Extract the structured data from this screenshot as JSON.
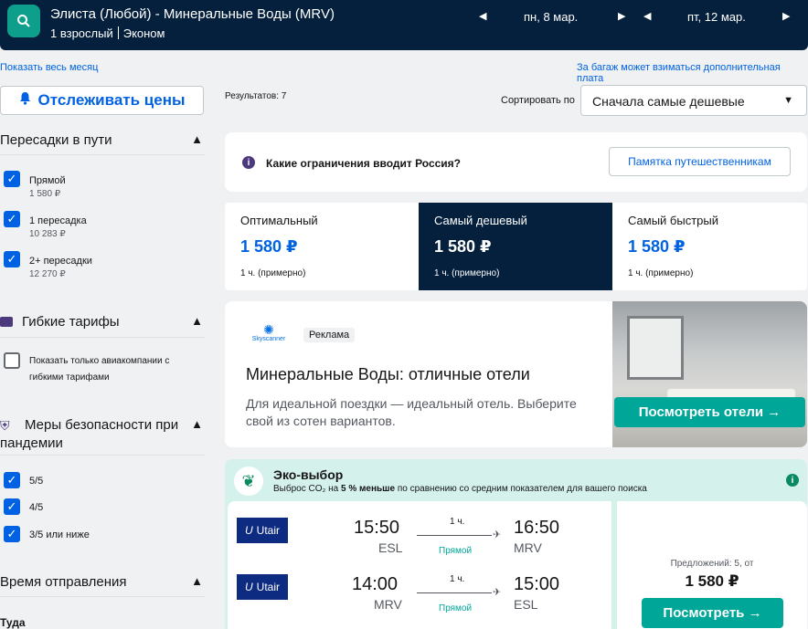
{
  "header": {
    "route": "Элиста (Любой) - Минеральные Воды (MRV)",
    "passengers": "1 взрослый",
    "cabin": "Эконом",
    "depart_date": "пн, 8 мар.",
    "return_date": "пт, 12 мар."
  },
  "links": {
    "show_month": "Показать весь месяц",
    "baggage_note": "За багаж может взиматься дополнительная плата"
  },
  "sidebar": {
    "track_prices": "Отслеживать цены",
    "stops": {
      "title": "Пересадки в пути",
      "options": [
        {
          "label": "Прямой",
          "price": "1 580 ₽"
        },
        {
          "label": "1 пересадка",
          "price": "10 283 ₽"
        },
        {
          "label": "2+ пересадки",
          "price": "12 270 ₽"
        }
      ]
    },
    "flex": {
      "title": "Гибкие тарифы",
      "option_line1": "Показать только авиакомпании с",
      "option_line2": "гибкими тарифами"
    },
    "safety": {
      "title_line1": "Меры безопасности при",
      "title_line2": "пандемии",
      "options": [
        "5/5",
        "4/5",
        "3/5 или ниже"
      ]
    },
    "departure": {
      "title": "Время отправления",
      "sub": "Туда"
    }
  },
  "main": {
    "results": "Результатов: 7",
    "sort_label": "Сортировать по",
    "sort_value": "Сначала самые дешевые",
    "info": {
      "text": "Какие ограничения вводит Россия?",
      "button": "Памятка путешественникам"
    },
    "tabs": [
      {
        "name": "Оптимальный",
        "price": "1 580 ₽",
        "duration": "1 ч. (примерно)"
      },
      {
        "name": "Самый дешевый",
        "price": "1 580 ₽",
        "duration": "1 ч. (примерно)"
      },
      {
        "name": "Самый быстрый",
        "price": "1 580 ₽",
        "duration": "1 ч. (примерно)"
      }
    ],
    "ad": {
      "logo": "Skyscanner",
      "badge": "Реклама",
      "title": "Минеральные Воды: отличные отели",
      "text": "Для идеальной поездки — идеальный отель. Выберите свой из сотен вариантов.",
      "button": "Посмотреть отели →"
    },
    "eco": {
      "title": "Эко-выбор",
      "text_before": "Выброс CO₂ на",
      "text_bold": "5 % меньше",
      "text_after": "по сравнению со средним показателем для вашего поиска"
    },
    "flight": {
      "airline": "Utair",
      "legs": [
        {
          "dep_time": "15:50",
          "dep_code": "ESL",
          "arr_time": "16:50",
          "arr_code": "MRV",
          "duration": "1 ч.",
          "type": "Прямой"
        },
        {
          "dep_time": "14:00",
          "dep_code": "MRV",
          "arr_time": "15:00",
          "arr_code": "ESL",
          "duration": "1 ч.",
          "type": "Прямой"
        }
      ],
      "offers": "Предложений: 5, от",
      "price": "1 580 ₽",
      "button": "Посмотреть →"
    }
  },
  "colors": {
    "navy": "#05203c",
    "blue": "#0062e3",
    "teal": "#00a698",
    "eco_bg": "#d4f1ec"
  }
}
